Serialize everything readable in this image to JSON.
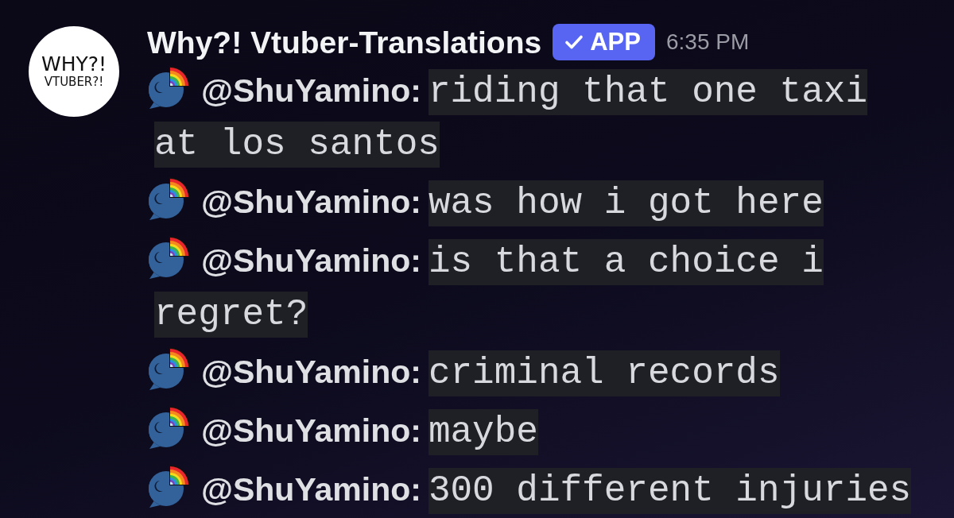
{
  "message": {
    "avatar": {
      "lines": [
        "WHY?!",
        "VTUBER?!"
      ]
    },
    "author": "Why?! Vtuber-Translations",
    "badge": "APP",
    "timestamp": "6:35 PM",
    "lines": [
      {
        "speaker": "@ShuYamino:",
        "text": "riding that one taxi at los santos"
      },
      {
        "speaker": "@ShuYamino:",
        "text": "was how i got here"
      },
      {
        "speaker": "@ShuYamino:",
        "text": "is that a choice i regret?"
      },
      {
        "speaker": "@ShuYamino:",
        "text": "criminal records"
      },
      {
        "speaker": "@ShuYamino:",
        "text": "maybe"
      },
      {
        "speaker": "@ShuYamino:",
        "text": "300 different injuries"
      }
    ]
  }
}
